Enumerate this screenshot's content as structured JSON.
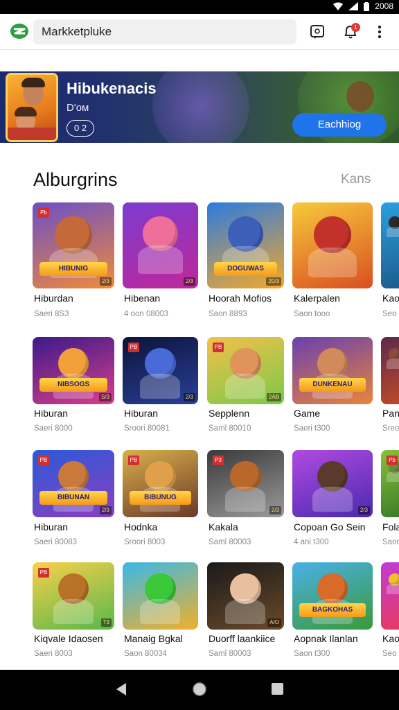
{
  "status_bar": {
    "time": "2008"
  },
  "app_bar": {
    "search_value": "Markketpluke",
    "notification_count": "1"
  },
  "banner": {
    "title": "Hibukenacis",
    "subtitle": "D'oм",
    "pill": "0 2",
    "button": "Eachhiog"
  },
  "section": {
    "title": "Alburgrins",
    "link": "Kans"
  },
  "cards": [
    {
      "title": "Hiburdan",
      "sub": "Saeri 8S3",
      "tag": "Pb",
      "corner": "2/3",
      "banner": "HIBUNIG",
      "bg": [
        "#6a4fc7",
        "#f08a3a"
      ],
      "face": "#c46a3a"
    },
    {
      "title": "Hibenan",
      "sub": "4 oon 08003",
      "tag": "",
      "corner": "2/3",
      "banner": "",
      "bg": [
        "#7b3ccf",
        "#c0279a"
      ],
      "face": "#ee6f9a"
    },
    {
      "title": "Hoorah Mofios",
      "sub": "Saon 8893",
      "tag": "",
      "corner": "20/3",
      "banner": "DOGUWAS",
      "bg": [
        "#2b7be0",
        "#f3a92b"
      ],
      "face": "#3c5fb8"
    },
    {
      "title": "Kalerpalen",
      "sub": "Saon tooo",
      "tag": "",
      "corner": "",
      "banner": "",
      "bg": [
        "#f7c93c",
        "#d94f20"
      ],
      "face": "#c2322a"
    },
    {
      "title": "Kao",
      "sub": "Seo",
      "tag": "",
      "corner": "",
      "banner": "",
      "bg": [
        "#2ba0e0",
        "#1b5a8a"
      ],
      "face": "#2b2b2b"
    },
    {
      "title": "Hiburan",
      "sub": "Saeri 8000",
      "tag": "",
      "corner": "S/3",
      "banner": "NIBSOGS",
      "bg": [
        "#3b1a8a",
        "#d93e8a"
      ],
      "face": "#f2a13a"
    },
    {
      "title": "Hiburan",
      "sub": "Sroori 80081",
      "tag": "PB",
      "corner": "2/3",
      "banner": "",
      "bg": [
        "#0c1438",
        "#2a3f9a"
      ],
      "face": "#4a6ad8"
    },
    {
      "title": "Sepplenn",
      "sub": "Saml 80010",
      "tag": "PB",
      "corner": "2AB",
      "banner": "",
      "bg": [
        "#f4c04a",
        "#7ac94a"
      ],
      "face": "#e0935a"
    },
    {
      "title": "Game",
      "sub": "Saeri t300",
      "tag": "",
      "corner": "",
      "banner": "DUNKENAU",
      "bg": [
        "#6a3fb0",
        "#e8843a"
      ],
      "face": "#d28a5a"
    },
    {
      "title": "Pan",
      "sub": "Sreo",
      "tag": "",
      "corner": "",
      "banner": "",
      "bg": [
        "#5b2a4a",
        "#c24a2a"
      ],
      "face": "#8a4a3a"
    },
    {
      "title": "Hiburan",
      "sub": "Saeri 80083",
      "tag": "PB",
      "corner": "2/3",
      "banner": "BIBUNAN",
      "bg": [
        "#2a5ad8",
        "#8a3fc0"
      ],
      "face": "#c97a3a"
    },
    {
      "title": "Hodnka",
      "sub": "Sroori 8003",
      "tag": "PB",
      "corner": "",
      "banner": "BIBUNUG",
      "bg": [
        "#d8b04a",
        "#6a3a2a"
      ],
      "face": "#e0a04a"
    },
    {
      "title": "Kakala",
      "sub": "Saml 80003",
      "tag": "P3",
      "corner": "2/3",
      "banner": "",
      "bg": [
        "#3a3a3a",
        "#9a9a9a"
      ],
      "face": "#b8682a"
    },
    {
      "title": "Copoan Go Sein",
      "sub": "4 ani t300",
      "tag": "",
      "corner": "2/3",
      "banner": "",
      "bg": [
        "#b04ae0",
        "#4a2ab0"
      ],
      "face": "#5a3a2a"
    },
    {
      "title": "Fola",
      "sub": "Saon",
      "tag": "Pb",
      "corner": "",
      "banner": "",
      "bg": [
        "#8ac03a",
        "#3a7a2a"
      ],
      "face": "#6a8a3a"
    },
    {
      "title": "Kiqvale Idaosen",
      "sub": "Saeri 8003",
      "tag": "PB",
      "corner": "T3",
      "banner": "",
      "bg": [
        "#f8d04a",
        "#58b84a"
      ],
      "face": "#b8722a"
    },
    {
      "title": "Manaig Bgkal",
      "sub": "Saon 80034",
      "tag": "",
      "corner": "",
      "banner": "",
      "bg": [
        "#3ab8e8",
        "#f0b02a"
      ],
      "face": "#3ac83a"
    },
    {
      "title": "Duorff laankiice",
      "sub": "Saml 80003",
      "tag": "",
      "corner": "A/O",
      "banner": "",
      "bg": [
        "#1a1a1a",
        "#6a4a2a"
      ],
      "face": "#e8c0a0"
    },
    {
      "title": "Aopnak Ilanlan",
      "sub": "Saon t300",
      "tag": "",
      "corner": "",
      "banner": "BAGKOHAS",
      "bg": [
        "#4ab0e8",
        "#3a9a3a"
      ],
      "face": "#d86a2a"
    },
    {
      "title": "Kao",
      "sub": "Seo",
      "tag": "",
      "corner": "",
      "banner": "",
      "bg": [
        "#c03ad8",
        "#e83a5a"
      ],
      "face": "#f0c02a"
    }
  ],
  "nav": {
    "back": "back-icon",
    "home": "home-icon",
    "recents": "recents-icon"
  }
}
